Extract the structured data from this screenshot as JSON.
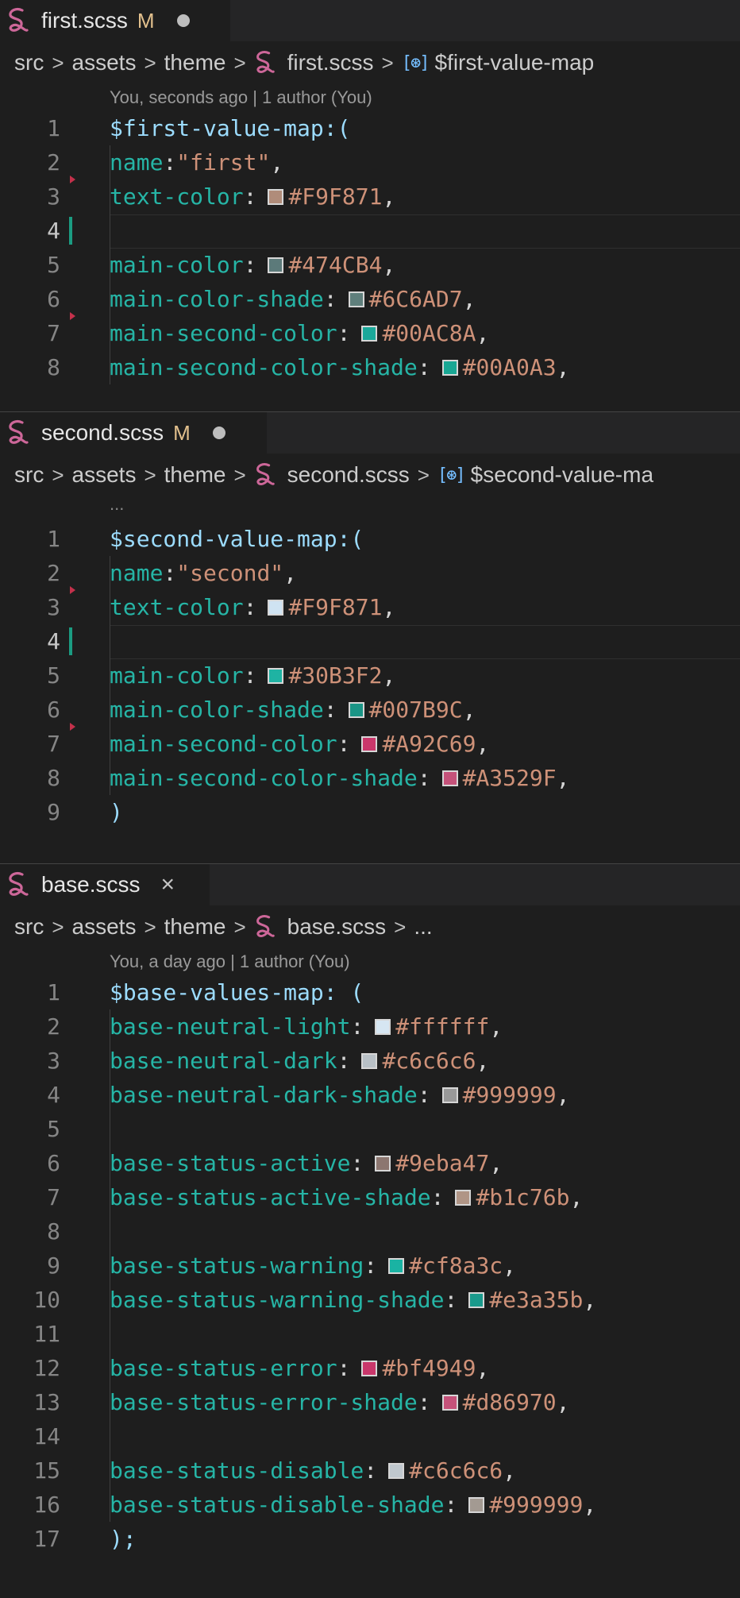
{
  "colors": {
    "sass_pink": "#cd6799",
    "modified": "#e2c08d",
    "added_gutter": "#1b9c82",
    "deleted_arrow": "#c4314b"
  },
  "panes": [
    {
      "tab": {
        "name": "first.scss",
        "status": "M",
        "icon": "sass-icon",
        "dirty": true
      },
      "breadcrumb": {
        "parts": [
          "src",
          "assets",
          "theme"
        ],
        "file": "first.scss",
        "symbol": "$first-value-map"
      },
      "lens": "You, seconds ago | 1 author (You)",
      "lines": [
        {
          "n": "1",
          "text": "$first-value-map:("
        },
        {
          "n": "2",
          "key": "name",
          "str": "\"first\""
        },
        {
          "n": "3",
          "key": "text-color",
          "value": "#F9F871",
          "swatch": "#b08c7a"
        },
        {
          "n": "4",
          "blank": true
        },
        {
          "n": "5",
          "key": "main-color",
          "value": "#474CB4",
          "swatch": "#5c7a7a"
        },
        {
          "n": "6",
          "key": "main-color-shade",
          "value": "#6C6AD7",
          "swatch": "#5f7f7c"
        },
        {
          "n": "7",
          "key": "main-second-color",
          "value": "#00AC8A",
          "swatch": "#1aa89a"
        },
        {
          "n": "8",
          "key": "main-second-color-shade",
          "value": "#00A0A3",
          "swatch": "#19a794"
        }
      ]
    },
    {
      "tab": {
        "name": "second.scss",
        "status": "M",
        "icon": "sass-icon",
        "dirty": true
      },
      "breadcrumb": {
        "parts": [
          "src",
          "assets",
          "theme"
        ],
        "file": "second.scss",
        "symbol": "$second-value-ma"
      },
      "ellipsis": "...",
      "lines": [
        {
          "n": "1",
          "text": "$second-value-map:("
        },
        {
          "n": "2",
          "key": "name",
          "str": "\"second\""
        },
        {
          "n": "3",
          "key": "text-color",
          "value": "#F9F871",
          "swatch": "#cfe3f2"
        },
        {
          "n": "4",
          "blank": true
        },
        {
          "n": "5",
          "key": "main-color",
          "value": "#30B3F2",
          "swatch": "#1fb3a3"
        },
        {
          "n": "6",
          "key": "main-color-shade",
          "value": "#007B9C",
          "swatch": "#1a9586"
        },
        {
          "n": "7",
          "key": "main-second-color",
          "value": "#A92C69",
          "swatch": "#c9376b"
        },
        {
          "n": "8",
          "key": "main-second-color-shade",
          "value": "#A3529F",
          "swatch": "#c5527a"
        },
        {
          "n": "9",
          "text": ")"
        }
      ]
    },
    {
      "tab": {
        "name": "base.scss",
        "close": "×",
        "icon": "sass-icon"
      },
      "breadcrumb": {
        "parts": [
          "src",
          "assets",
          "theme"
        ],
        "file": "base.scss",
        "symbol": "..."
      },
      "lens": "You, a day ago | 1 author (You)",
      "lines": [
        {
          "n": "1",
          "text": "$base-values-map: ("
        },
        {
          "n": "2",
          "key": "base-neutral-light",
          "value": "#ffffff",
          "swatch": "#d6e6f2"
        },
        {
          "n": "3",
          "key": "base-neutral-dark",
          "value": "#c6c6c6",
          "swatch": "#b8c0c6"
        },
        {
          "n": "4",
          "key": "base-neutral-dark-shade",
          "value": "#999999",
          "swatch": "#999999"
        },
        {
          "n": "5",
          "blank": true
        },
        {
          "n": "6",
          "key": "base-status-active",
          "value": "#9eba47",
          "swatch": "#8c7670"
        },
        {
          "n": "7",
          "key": "base-status-active-shade",
          "value": "#b1c76b",
          "swatch": "#b09586"
        },
        {
          "n": "8",
          "blank": true
        },
        {
          "n": "9",
          "key": "base-status-warning",
          "value": "#cf8a3c",
          "swatch": "#1ab3a3"
        },
        {
          "n": "10",
          "key": "base-status-warning-shade",
          "value": "#e3a35b",
          "swatch": "#1a9a8c"
        },
        {
          "n": "11",
          "blank": true
        },
        {
          "n": "12",
          "key": "base-status-error",
          "value": "#bf4949",
          "swatch": "#c9376b"
        },
        {
          "n": "13",
          "key": "base-status-error-shade",
          "value": "#d86970",
          "swatch": "#c5527a"
        },
        {
          "n": "14",
          "blank": true
        },
        {
          "n": "15",
          "key": "base-status-disable",
          "value": "#c6c6c6",
          "swatch": "#c0c8ce"
        },
        {
          "n": "16",
          "key": "base-status-disable-shade",
          "value": "#999999",
          "swatch": "#a39a92"
        },
        {
          "n": "17",
          "text": ");"
        }
      ]
    }
  ]
}
